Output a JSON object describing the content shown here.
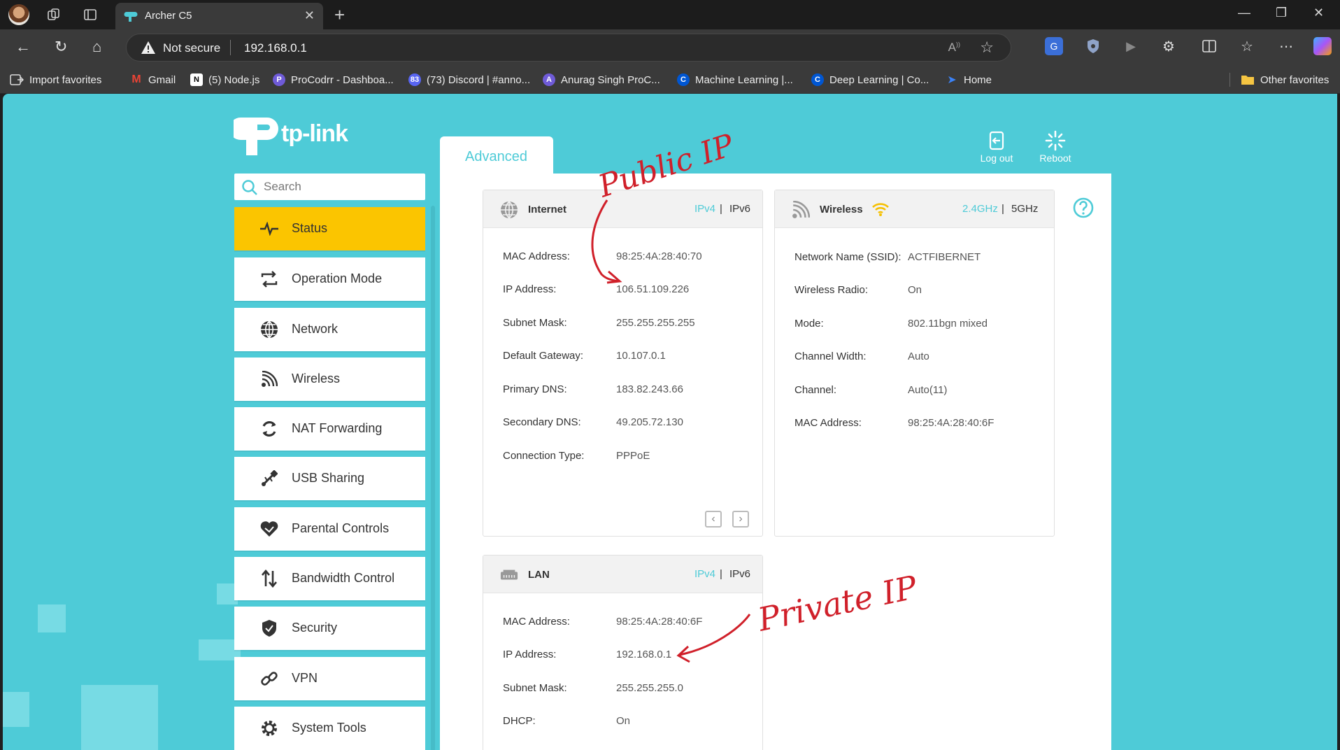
{
  "browser": {
    "tab_title": "Archer C5",
    "address": {
      "security_label": "Not secure",
      "url": "192.168.0.1"
    },
    "bookmarks": [
      {
        "label": "Import favorites",
        "icon": "import-icon"
      },
      {
        "label": "Gmail",
        "icon": "gmail-icon",
        "color": "#ea4335"
      },
      {
        "label": "(5) Node.js",
        "icon": "notion-icon",
        "color": "#ffffff"
      },
      {
        "label": "ProCodrr - Dashboa...",
        "icon": "procodrr-icon",
        "color": "#6f5bd8"
      },
      {
        "label": "(73) Discord | #anno...",
        "icon": "discord-icon",
        "color": "#5865f2"
      },
      {
        "label": "Anurag Singh ProC...",
        "icon": "avatar-icon",
        "color": "#6f5bd8"
      },
      {
        "label": "Machine Learning |...",
        "icon": "coursera-icon",
        "color": "#0056d2"
      },
      {
        "label": "Deep Learning | Co...",
        "icon": "coursera-icon",
        "color": "#0056d2"
      },
      {
        "label": "Home",
        "icon": "home-bookmark-icon",
        "color": "#3b82f6"
      }
    ],
    "other_favorites": "Other favorites"
  },
  "router": {
    "brand": "tp-link",
    "search_placeholder": "Search",
    "tab_label": "Advanced",
    "logout_label": "Log out",
    "reboot_label": "Reboot",
    "menu": [
      {
        "label": "Status",
        "icon": "status-pulse-icon",
        "active": true
      },
      {
        "label": "Operation Mode",
        "icon": "operation-mode-icon"
      },
      {
        "label": "Network",
        "icon": "globe-icon"
      },
      {
        "label": "Wireless",
        "icon": "wifi-icon"
      },
      {
        "label": "NAT Forwarding",
        "icon": "nat-icon"
      },
      {
        "label": "USB Sharing",
        "icon": "usb-icon"
      },
      {
        "label": "Parental Controls",
        "icon": "heart-icon"
      },
      {
        "label": "Bandwidth Control",
        "icon": "bandwidth-icon"
      },
      {
        "label": "Security",
        "icon": "shield-icon"
      },
      {
        "label": "VPN",
        "icon": "vpn-icon"
      },
      {
        "label": "System Tools",
        "icon": "gear-icon"
      }
    ],
    "internet": {
      "title": "Internet",
      "ipv4": "IPv4",
      "ipv6": "IPv6",
      "rows": [
        {
          "key": "MAC Address:",
          "value": "98:25:4A:28:40:70"
        },
        {
          "key": "IP Address:",
          "value": "106.51.109.226"
        },
        {
          "key": "Subnet Mask:",
          "value": "255.255.255.255"
        },
        {
          "key": "Default Gateway:",
          "value": "10.107.0.1"
        },
        {
          "key": "Primary DNS:",
          "value": "183.82.243.66"
        },
        {
          "key": "Secondary DNS:",
          "value": "49.205.72.130"
        },
        {
          "key": "Connection Type:",
          "value": "PPPoE"
        }
      ]
    },
    "wireless": {
      "title": "Wireless",
      "band_24": "2.4GHz",
      "band_5": "5GHz",
      "rows": [
        {
          "key": "Network Name (SSID):",
          "value": "ACTFIBERNET"
        },
        {
          "key": "Wireless Radio:",
          "value": "On"
        },
        {
          "key": "Mode:",
          "value": "802.11bgn mixed"
        },
        {
          "key": "Channel Width:",
          "value": "Auto"
        },
        {
          "key": "Channel:",
          "value": "Auto(11)"
        },
        {
          "key": "MAC Address:",
          "value": "98:25:4A:28:40:6F"
        }
      ]
    },
    "lan": {
      "title": "LAN",
      "ipv4": "IPv4",
      "ipv6": "IPv6",
      "rows": [
        {
          "key": "MAC Address:",
          "value": "98:25:4A:28:40:6F"
        },
        {
          "key": "IP Address:",
          "value": "192.168.0.1"
        },
        {
          "key": "Subnet Mask:",
          "value": "255.255.255.0"
        },
        {
          "key": "DHCP:",
          "value": "On"
        }
      ]
    }
  },
  "annotations": {
    "public": "Public IP",
    "private": "Private IP"
  },
  "colors": {
    "accent": "#4ecbd7",
    "active_menu": "#fbc500",
    "annotation": "#d0202a"
  }
}
